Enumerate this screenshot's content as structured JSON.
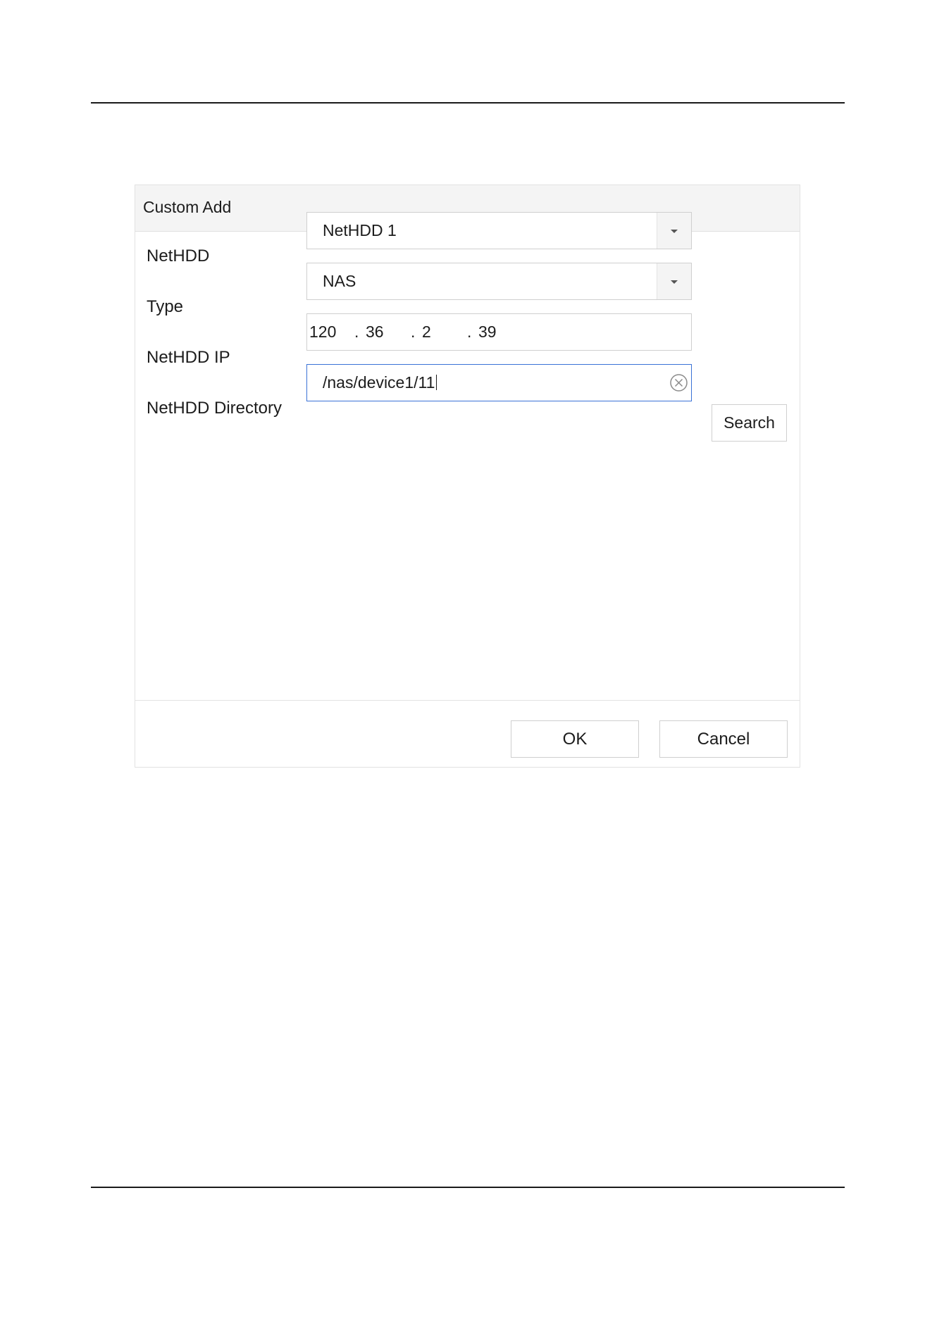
{
  "dialog": {
    "title": "Custom Add"
  },
  "form": {
    "nethdd": {
      "label": "NetHDD",
      "value": "NetHDD 1"
    },
    "type": {
      "label": "Type",
      "value": "NAS"
    },
    "ip": {
      "label": "NetHDD IP",
      "octets": [
        "120",
        "36",
        "2",
        "39"
      ],
      "separator": "."
    },
    "directory": {
      "label": "NetHDD Directory",
      "value": "/nas/device1/11"
    },
    "search_label": "Search"
  },
  "footer": {
    "ok_label": "OK",
    "cancel_label": "Cancel"
  },
  "icons": {
    "dropdown": "chevron-down-icon",
    "clear": "clear-circle-x-icon"
  },
  "colors": {
    "focus_border": "#3a72d6",
    "header_bg": "#f4f4f4"
  }
}
